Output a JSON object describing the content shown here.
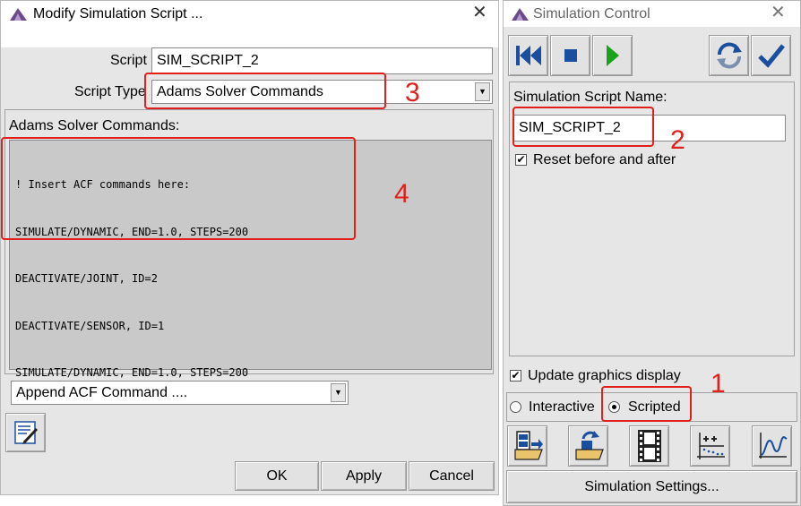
{
  "modify_dialog": {
    "title": "Modify Simulation Script ...",
    "close_glyph": "✕",
    "script_label": "Script",
    "script_value": "SIM_SCRIPT_2",
    "script_type_label": "Script Type",
    "script_type_value": "Adams Solver Commands",
    "commands_label": "Adams Solver Commands:",
    "commands": [
      "! Insert ACF commands here:",
      "SIMULATE/DYNAMIC, END=1.0, STEPS=200",
      "DEACTIVATE/JOINT, ID=2",
      "DEACTIVATE/SENSOR, ID=1",
      "SIMULATE/DYNAMIC, END=1.0, STEPS=200"
    ],
    "append_value": "Append ACF Command ....",
    "buttons": {
      "ok": "OK",
      "apply": "Apply",
      "cancel": "Cancel"
    }
  },
  "sim_control": {
    "title": "Simulation Control",
    "close_glyph": "✕",
    "script_name_label": "Simulation Script Name:",
    "script_name_value": "SIM_SCRIPT_2",
    "reset_label": "Reset before and after",
    "reset_checked": "✔",
    "update_label": "Update graphics display",
    "update_checked": "✔",
    "interactive_label": "Interactive",
    "scripted_label": "Scripted",
    "settings_button": "Simulation Settings..."
  },
  "annotations": [
    "1",
    "2",
    "3",
    "4"
  ],
  "colors": {
    "annotation": "#e0201c",
    "window_bg": "#e6e6e6",
    "code_bg": "#c9c9c9",
    "accent_blue": "#1a4fa0",
    "play_green": "#1aa31a"
  }
}
